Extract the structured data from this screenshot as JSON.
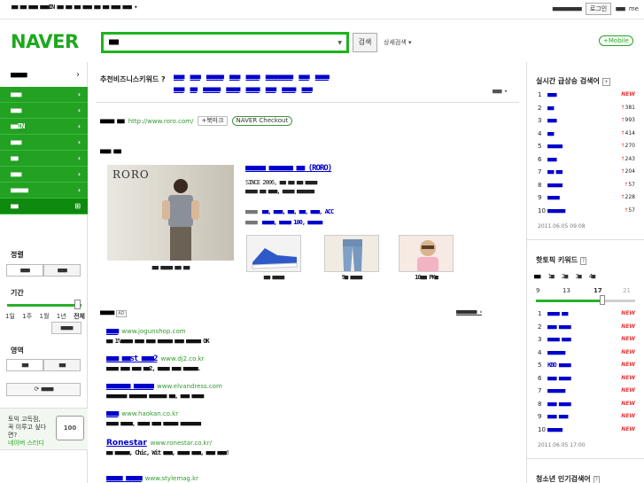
{
  "top_bar": {
    "left_text": "■■ ■■ ■■■ ■■■IN ■■  ■■ ■■ ■■■ ■■ ■■ ■■■ ■■■ ▾",
    "right_text": "■■■■■■■■■■",
    "login": "로그인",
    "right_short": "■■■",
    "me": "me"
  },
  "logo": "NAVER",
  "search": {
    "value": "■■",
    "button": "검색",
    "detail": "상세검색 ▾"
  },
  "mobile_button": "+Mobile",
  "sidebar": {
    "category_title": "■■■■",
    "category_arrow": "›",
    "menu": [
      "■■■",
      "■■■",
      "■■IN",
      "■■■",
      "■■",
      "■■■",
      "■■■■■",
      "■■"
    ],
    "sort_label": "정렬",
    "sort_options": [
      "■■■",
      "■■■"
    ],
    "period_label": "기간",
    "period_ticks": [
      "1일",
      "1주",
      "1월",
      "1년",
      "전체"
    ],
    "period_value": "■■■■",
    "area_label": "영역",
    "area_options": [
      "■■",
      "■■"
    ],
    "reset_button": "⟳ ■■■■",
    "ad_text_1": "토익 고득점,",
    "ad_text_2": "꼭 이루고 싶다면?",
    "ad_brand": "네이버 스터디",
    "ad_badge": "100"
  },
  "recommend": {
    "label": "추천비즈니스키워드 ?",
    "row1": [
      "■■■",
      "■■■",
      "■■■■■",
      "■■■",
      "■■■■",
      "■■■■■■■■",
      "■■■",
      "■■■■"
    ],
    "row2": [
      "■■■",
      "■■",
      "■■■■■",
      "■■■■",
      "■■■■",
      "■■■",
      "■■■■",
      "■■■"
    ],
    "more": "■■■ ▾"
  },
  "site_result": {
    "title": "■■■■ ■■",
    "url": "http://www.roro.com/",
    "bookmark": "+북마크",
    "checkout": "NAVER Checkout"
  },
  "shop": {
    "section_title": "■■■ ■■",
    "photo_logo": "RORO",
    "photo_caption": "■■ ■■■■ ■■ ■■",
    "name": "■■■■■ ■■■■■■ ■■ (RORO)",
    "since": "SINCE 2006, ■■ ■■ ■■ ■■■■",
    "desc": "■■■■ ■■ ■■■, ■■■■ ■■■■■■",
    "tags1_label": "■■■■",
    "tags1": "■■, ■■■, ■■, ■■, ■■■, ACC",
    "tags2_label": "■■■■",
    "tags2": "■■■■, ■■■■ 100, ■■■■■",
    "thumb_captions": [
      "■■ ■■■■",
      "9■ ■■■■",
      "10■■ PK■"
    ]
  },
  "ads": {
    "title": "■■■■",
    "mark": "AD",
    "register": "■■■■■■■ ›",
    "items": [
      {
        "name": "■■■",
        "url": "www.jogunshop.com",
        "desc": "■■ 1%■■■■ ■■■ ■■■ ■■■■■ ■■■ ■■■■■ OK"
      },
      {
        "name": "■■■ ■■st ■■■2",
        "url": "www.dj2.co.kr",
        "desc": "■■■■ ■■■ ■■■ ■■2, ■■■■ ■■■ ■■■■■."
      },
      {
        "name": "■■■■■■ ■■■■■",
        "url": "www.elvandress.com",
        "desc": "■■■■■■■ ■■■■■■ ■■■■■■ ■■, ■■■ ■■■■"
      },
      {
        "name": "■■■",
        "url": "www.haokan.co.kr",
        "desc": "■■■■ ■■■■, ■■■■ ■■■ ■■■■■ ■■■■■■■"
      },
      {
        "name": "Ronestar",
        "url": "www.ronestar.co.kr/",
        "desc": "■■ ■■■■■, Chic, Wit ■■■, ■■■■ ■■■, ■■■ ■■■!"
      },
      {
        "name": "■■■■ ■■■■",
        "url": "www.stylemag.kr",
        "desc": ""
      }
    ]
  },
  "realtime": {
    "title": "실시간 급상승 검색어",
    "items": [
      {
        "rank": "1",
        "keyword": "■■■",
        "delta": "NEW",
        "is_new": true
      },
      {
        "rank": "2",
        "keyword": "■■",
        "delta": "381",
        "is_new": false
      },
      {
        "rank": "3",
        "keyword": "■■■",
        "delta": "993",
        "is_new": false
      },
      {
        "rank": "4",
        "keyword": "■■",
        "delta": "414",
        "is_new": false
      },
      {
        "rank": "5",
        "keyword": "■■■■■",
        "delta": "270",
        "is_new": false
      },
      {
        "rank": "6",
        "keyword": "■■■",
        "delta": "243",
        "is_new": false
      },
      {
        "rank": "7",
        "keyword": "■■ ■■",
        "delta": "204",
        "is_new": false
      },
      {
        "rank": "8",
        "keyword": "■■■■■",
        "delta": "57",
        "is_new": false
      },
      {
        "rank": "9",
        "keyword": "■■■■",
        "delta": "228",
        "is_new": false
      },
      {
        "rank": "10",
        "keyword": "■■■■■■",
        "delta": "57",
        "is_new": false
      }
    ],
    "time": "2011.06.05 09:08"
  },
  "hot_topic": {
    "title": "핫토픽 키워드",
    "tabs": [
      "■■",
      "1■",
      "2■",
      "3■",
      "4■"
    ],
    "scale": [
      "9",
      "13",
      "17",
      "21"
    ],
    "items": [
      {
        "rank": "1",
        "keyword": "■■■■ ■■",
        "is_new": true
      },
      {
        "rank": "2",
        "keyword": "■■■ ■■■■",
        "is_new": true
      },
      {
        "rank": "3",
        "keyword": "■■■■ ■■■",
        "is_new": true
      },
      {
        "rank": "4",
        "keyword": "■■■■■■",
        "is_new": true
      },
      {
        "rank": "5",
        "keyword": "KBO ■■■■",
        "is_new": true
      },
      {
        "rank": "6",
        "keyword": "■■■ ■■■■",
        "is_new": true
      },
      {
        "rank": "7",
        "keyword": "■■■■■■",
        "is_new": true
      },
      {
        "rank": "8",
        "keyword": "■■■ ■■■■",
        "is_new": true
      },
      {
        "rank": "9",
        "keyword": "■■■ ■■■",
        "is_new": true
      },
      {
        "rank": "10",
        "keyword": "■■■■■",
        "is_new": true
      }
    ],
    "time": "2011.06.05 17:00"
  },
  "youth": {
    "title": "청소년 인기검색어"
  },
  "colors": {
    "brand": "#1ea81e",
    "link": "#0000cc",
    "url": "#339933",
    "up": "#ee3333"
  }
}
